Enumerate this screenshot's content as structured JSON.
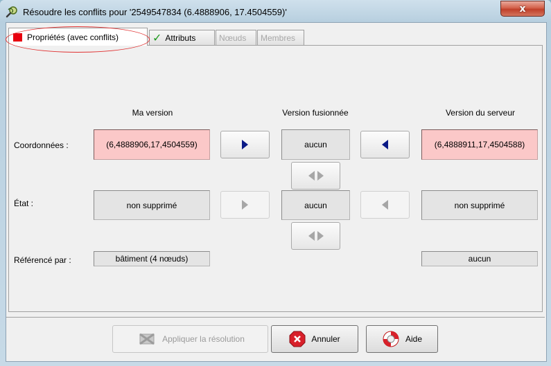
{
  "window": {
    "title": "Résoudre les conflits pour '2549547834 (6.4888906, 17.4504559)'",
    "close_label": "x"
  },
  "tabs": [
    {
      "label": "Propriétés (avec conflits)",
      "state": "active",
      "icon": "conflict-red-square-icon"
    },
    {
      "label": "Attributs",
      "state": "normal",
      "icon": "checkmark-icon"
    },
    {
      "label": "Nœuds",
      "state": "disabled"
    },
    {
      "label": "Membres",
      "state": "disabled"
    }
  ],
  "columns": {
    "my_version": "Ma version",
    "merged": "Version fusionnée",
    "server": "Version du serveur"
  },
  "rows": {
    "coords": {
      "label": "Coordonnées :",
      "mine": "(6,4888906,17,4504559)",
      "merged": "aucun",
      "server": "(6,4888911,17,4504588)"
    },
    "state": {
      "label": "État :",
      "mine": "non supprimé",
      "merged": "aucun",
      "server": "non supprimé"
    },
    "refs": {
      "label": "Référencé par :",
      "mine": "bâtiment (4 nœuds)",
      "server": "aucun"
    }
  },
  "buttons": {
    "apply": "Appliquer la résolution",
    "cancel": "Annuler",
    "help": "Aide"
  },
  "colors": {
    "conflict_bg": "#fbc8c8",
    "arrow": "#0a1a86",
    "highlight_ellipse": "#e03030"
  }
}
